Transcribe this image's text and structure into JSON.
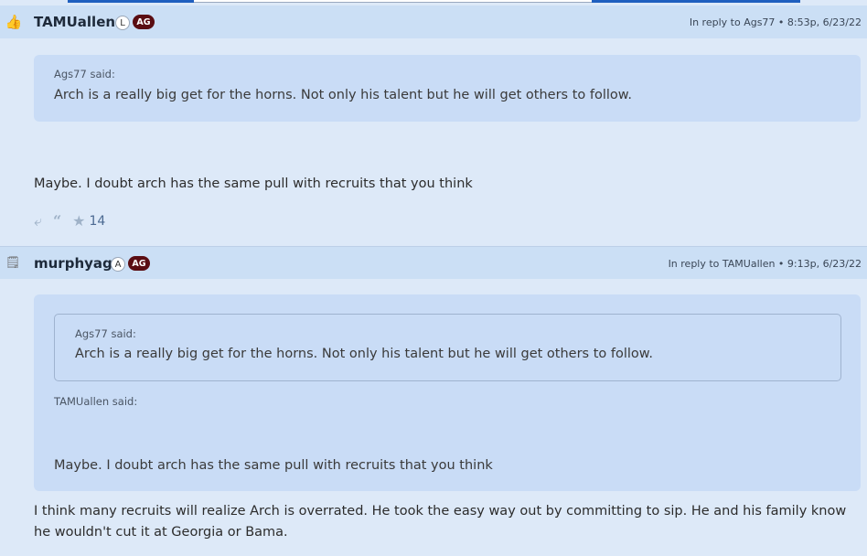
{
  "post1": {
    "username": "TAMUallen",
    "badge_letter": "L",
    "badge_group": "AG",
    "reply_meta": "In reply to Ags77 • 8:53p, 6/23/22",
    "quote": {
      "author_said": "Ags77 said:",
      "text": "Arch is a really big get for the horns. Not only his talent but he will get others to follow."
    },
    "body": "Maybe. I doubt arch has the same pull with recruits that you think",
    "actions": {
      "reply_icon": "reply-arrow-icon",
      "quote_icon": "quote-icon",
      "star_icon": "star-icon",
      "star_count": "14"
    }
  },
  "post2": {
    "username": "murphyag",
    "badge_letter": "A",
    "badge_group": "AG",
    "reply_meta": "In reply to TAMUallen • 9:13p, 6/23/22",
    "quote": {
      "nested": {
        "author_said": "Ags77 said:",
        "text": "Arch is a really big get for the horns. Not only his talent but he will get others to follow."
      },
      "author_said": "TAMUallen said:",
      "text": "Maybe. I doubt arch has the same pull with recruits that you think"
    },
    "body": "I think many recruits will realize Arch is overrated. He took the easy way out by committing to sip. He and his family know he wouldn't cut it at Georgia or Bama."
  },
  "colors": {
    "background": "#dde9f8",
    "header": "#cbdff5",
    "quote": "#c9dcf6",
    "ag_badge": "#5a0d12"
  }
}
